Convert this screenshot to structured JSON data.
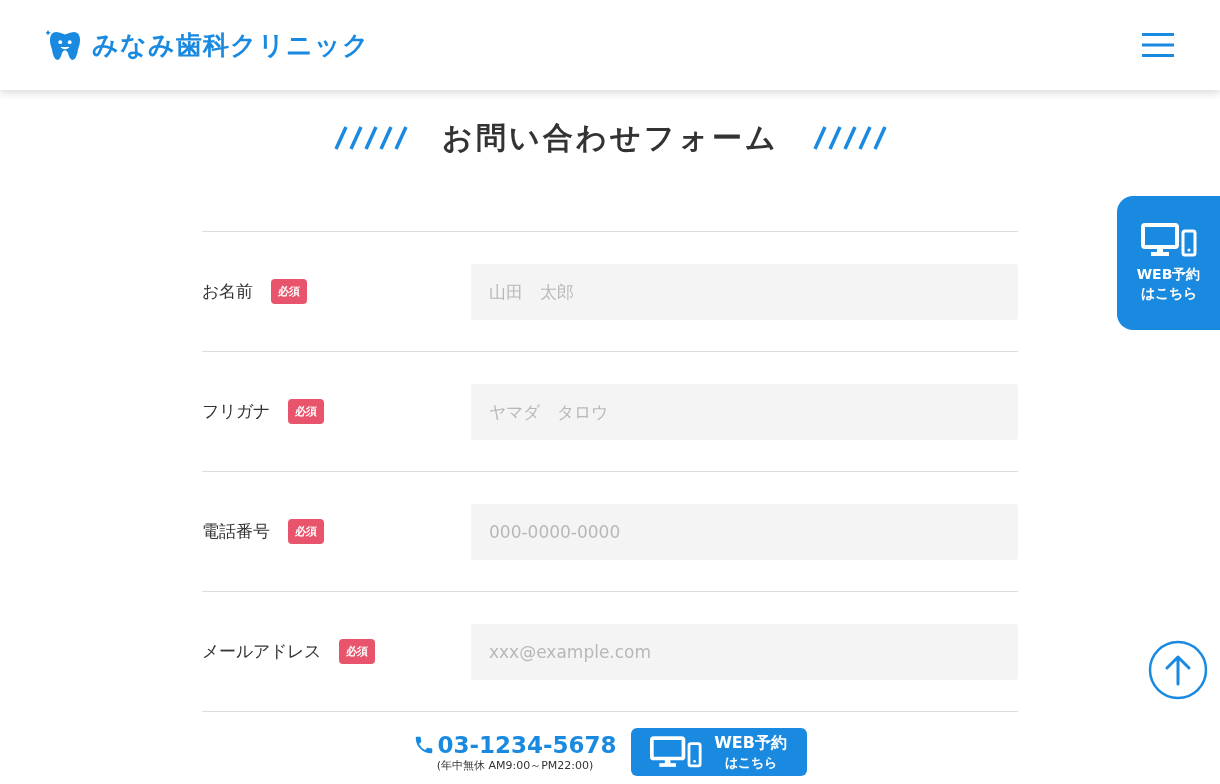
{
  "header": {
    "logo_text": "みなみ歯科クリニック"
  },
  "title": "お問い合わせフォーム",
  "fields": [
    {
      "label": "お名前",
      "badge": "必須",
      "placeholder": "山田　太郎"
    },
    {
      "label": "フリガナ",
      "badge": "必須",
      "placeholder": "ヤマダ　タロウ"
    },
    {
      "label": "電話番号",
      "badge": "必須",
      "placeholder": "000-0000-0000"
    },
    {
      "label": "メールアドレス",
      "badge": "必須",
      "placeholder": "xxx@example.com"
    }
  ],
  "side_button": {
    "line_1": "WEB予約",
    "line_2": "はこちら"
  },
  "bottom_bar": {
    "phone": "03-1234-5678",
    "hours": "(年中無休 AM9:00～PM22:00)",
    "web_line_1": "WEB予約",
    "web_line_2": "はこちら"
  }
}
